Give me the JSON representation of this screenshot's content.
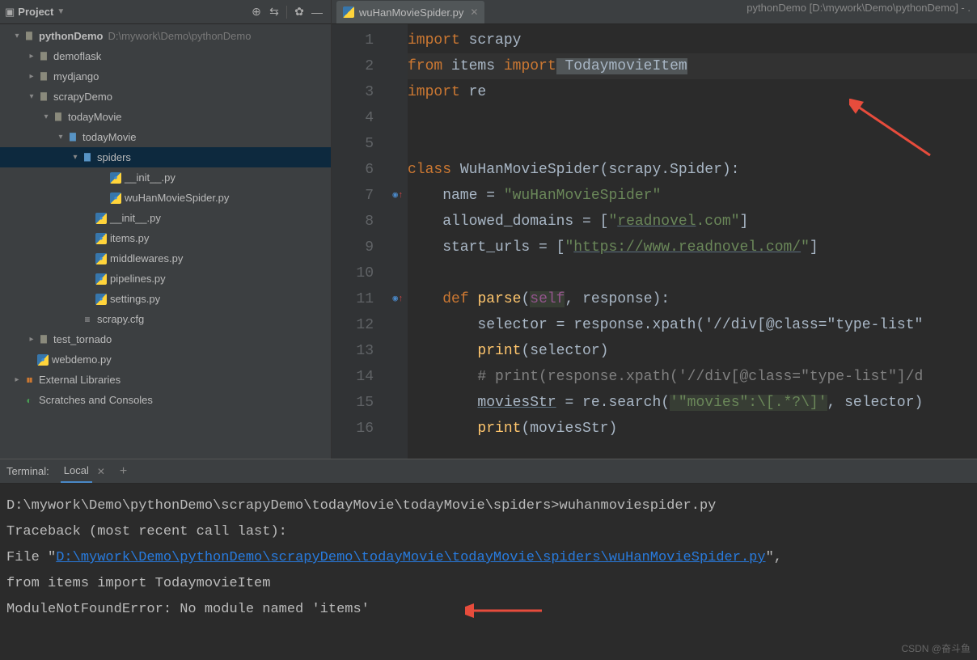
{
  "window_title": "pythonDemo [D:\\mywork\\Demo\\pythonDemo] - .",
  "sidebar": {
    "title": "Project"
  },
  "tree": {
    "root": {
      "name": "pythonDemo",
      "path": "D:\\mywork\\Demo\\pythonDemo"
    },
    "items": [
      {
        "chev": "▸",
        "icon": "folder",
        "name": "demoflask",
        "pad": 1
      },
      {
        "chev": "▸",
        "icon": "folder",
        "name": "mydjango",
        "pad": 1
      },
      {
        "chev": "▾",
        "icon": "folder",
        "name": "scrapyDemo",
        "pad": 1
      },
      {
        "chev": "▾",
        "icon": "folder",
        "name": "todayMovie",
        "pad": 2
      },
      {
        "chev": "▾",
        "icon": "folder-blue",
        "name": "todayMovie",
        "pad": 3
      },
      {
        "chev": "▾",
        "icon": "folder-blue",
        "name": "spiders",
        "pad": 4,
        "selected": true
      },
      {
        "chev": " ",
        "icon": "py",
        "name": "__init__.py",
        "pad": 6
      },
      {
        "chev": " ",
        "icon": "py",
        "name": "wuHanMovieSpider.py",
        "pad": 6
      },
      {
        "chev": " ",
        "icon": "py",
        "name": "__init__.py",
        "pad": 5
      },
      {
        "chev": " ",
        "icon": "py",
        "name": "items.py",
        "pad": 5
      },
      {
        "chev": " ",
        "icon": "py",
        "name": "middlewares.py",
        "pad": 5
      },
      {
        "chev": " ",
        "icon": "py",
        "name": "pipelines.py",
        "pad": 5
      },
      {
        "chev": " ",
        "icon": "py",
        "name": "settings.py",
        "pad": 5
      },
      {
        "chev": " ",
        "icon": "cfg",
        "name": "scrapy.cfg",
        "pad": 4
      },
      {
        "chev": "▸",
        "icon": "folder",
        "name": "test_tornado",
        "pad": 1
      },
      {
        "chev": " ",
        "icon": "py",
        "name": "webdemo.py",
        "pad": 1
      }
    ],
    "ext1": "External Libraries",
    "ext2": "Scratches and Consoles"
  },
  "tab": {
    "name": "wuHanMovieSpider.py",
    "close": "✕"
  },
  "code_lines": [
    "1",
    "2",
    "3",
    "4",
    "5",
    "6",
    "7",
    "8",
    "9",
    "10",
    "11",
    "12",
    "13",
    "14",
    "15",
    "16"
  ],
  "code": {
    "l1_a": "import",
    "l1_b": " scrapy",
    "l2_a": "from",
    "l2_b": " items ",
    "l2_c": "import",
    "l2_d": " TodaymovieItem",
    "l3_a": "import",
    "l3_b": " re",
    "l6_a": "class ",
    "l6_b": "WuHanMovieSpider",
    "l6_c": "(scrapy.Spider):",
    "l7_a": "    name = ",
    "l7_b": "\"wuHanMovieSpider\"",
    "l8_a": "    allowed_domains = [",
    "l8_b": "\"",
    "l8_c": "readnovel",
    "l8_d": ".com\"",
    "l8_e": "]",
    "l9_a": "    start_urls = [",
    "l9_b": "\"",
    "l9_c": "https://www.readnovel.com/",
    "l9_d": "\"",
    "l9_e": "]",
    "l11_a": "    ",
    "l11_b": "def ",
    "l11_c": "parse",
    "l11_d": "(",
    "l11_e": "self",
    "l11_f": ", response):",
    "l12": "        selector = response.xpath('//div[@class=\"type-list\"",
    "l13_a": "        ",
    "l13_b": "print",
    "l13_c": "(selector)",
    "l14": "        # print(response.xpath('//div[@class=\"type-list\"]/d",
    "l15_a": "        ",
    "l15_b": "moviesStr",
    "l15_c": " = re.search(",
    "l15_d": "'\"movies\":\\[.*?\\]'",
    "l15_e": ", selector)",
    "l16_a": "        ",
    "l16_b": "print",
    "l16_c": "(moviesStr)"
  },
  "terminal": {
    "title": "Terminal:",
    "tab": "Local",
    "l1": "D:\\mywork\\Demo\\pythonDemo\\scrapyDemo\\todayMovie\\todayMovie\\spiders>wuhanmoviespider.py",
    "l2": "Traceback (most recent call last):",
    "l3_a": "  File \"",
    "l3_link": "D:\\mywork\\Demo\\pythonDemo\\scrapyDemo\\todayMovie\\todayMovie\\spiders\\wuHanMovieSpider.py",
    "l3_b": "\",",
    "l4": "    from items import TodaymovieItem",
    "l5": "ModuleNotFoundError: No module named 'items'"
  },
  "watermark": "CSDN @奋斗鱼"
}
